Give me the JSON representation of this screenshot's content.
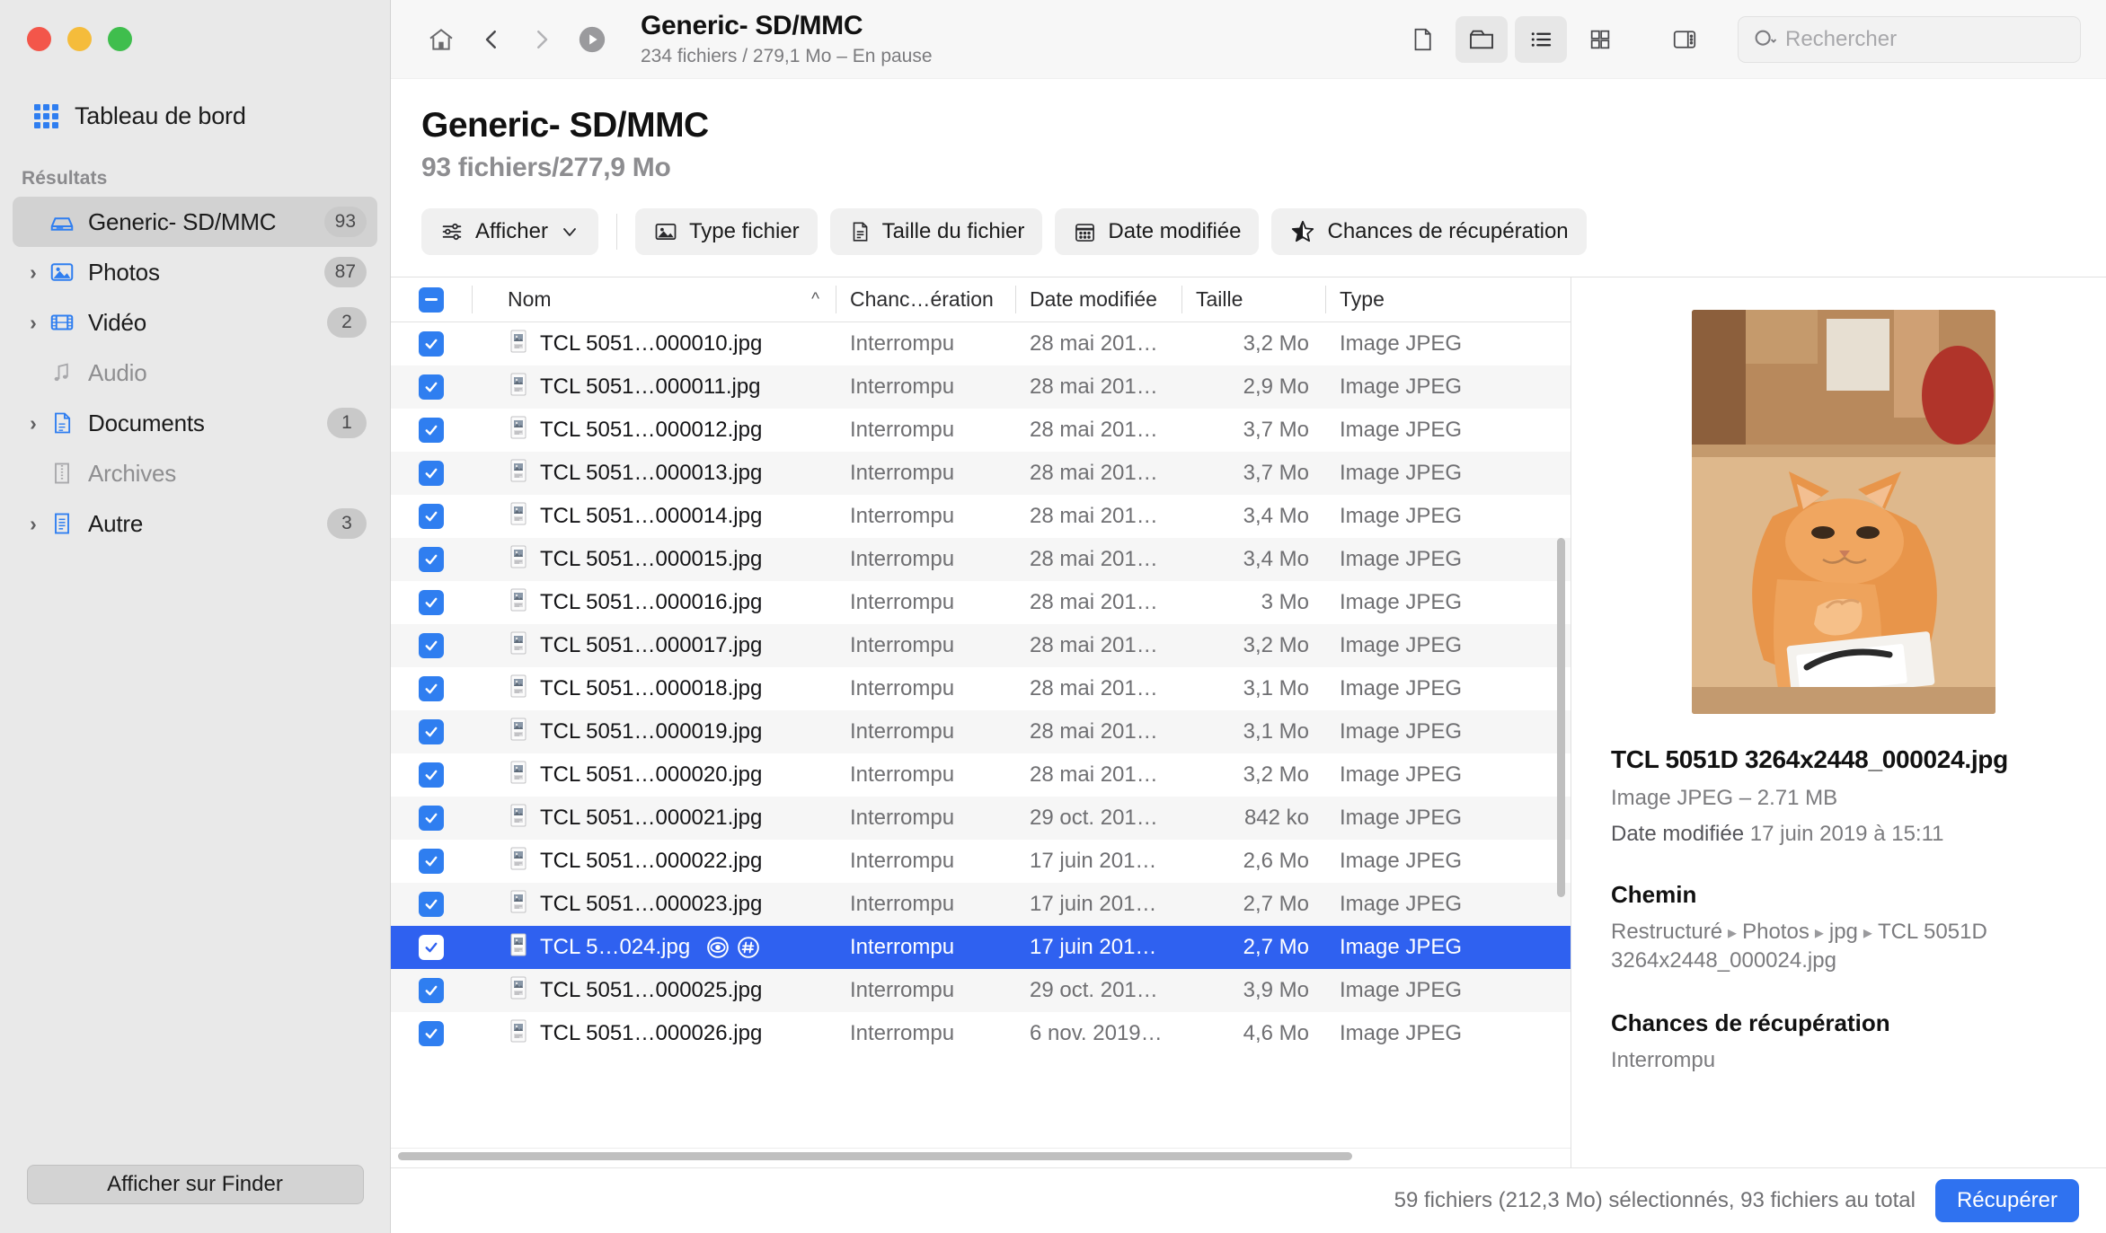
{
  "window": {
    "traffic_lights": [
      "close",
      "minimize",
      "zoom"
    ]
  },
  "sidebar": {
    "dashboard_label": "Tableau de bord",
    "section_label": "Résultats",
    "items": [
      {
        "label": "Generic- SD/MMC",
        "badge": "93",
        "icon": "drive-icon",
        "expandable": false,
        "selected": true,
        "dim": false
      },
      {
        "label": "Photos",
        "badge": "87",
        "icon": "photos-icon",
        "expandable": true,
        "selected": false,
        "dim": false
      },
      {
        "label": "Vidéo",
        "badge": "2",
        "icon": "video-icon",
        "expandable": true,
        "selected": false,
        "dim": false
      },
      {
        "label": "Audio",
        "badge": "",
        "icon": "audio-icon",
        "expandable": false,
        "selected": false,
        "dim": true
      },
      {
        "label": "Documents",
        "badge": "1",
        "icon": "document-icon",
        "expandable": true,
        "selected": false,
        "dim": false
      },
      {
        "label": "Archives",
        "badge": "",
        "icon": "archive-icon",
        "expandable": false,
        "selected": false,
        "dim": true
      },
      {
        "label": "Autre",
        "badge": "3",
        "icon": "other-icon",
        "expandable": true,
        "selected": false,
        "dim": false
      }
    ],
    "finder_button": "Afficher sur Finder"
  },
  "toolbar": {
    "home_icon": "home-icon",
    "back_icon": "chevron-left-icon",
    "forward_icon": "chevron-right-icon",
    "play_icon": "play-circle-icon",
    "title": "Generic- SD/MMC",
    "subtitle": "234 fichiers / 279,1 Mo – En pause",
    "view_icons": [
      "file-view-icon",
      "folder-view-icon",
      "list-view-icon",
      "grid-view-icon",
      "sidebar-toggle-icon"
    ],
    "search_placeholder": "Rechercher"
  },
  "header": {
    "title": "Generic- SD/MMC",
    "subtitle": "93 fichiers/277,9 Mo"
  },
  "filters": {
    "show": {
      "label": "Afficher",
      "icon": "sliders-icon",
      "caret": "chevron-down-icon"
    },
    "pills": [
      {
        "label": "Type fichier",
        "icon": "image-icon"
      },
      {
        "label": "Taille du fichier",
        "icon": "document-icon"
      },
      {
        "label": "Date modifiée",
        "icon": "calendar-icon"
      },
      {
        "label": "Chances de récupération",
        "icon": "star-icon"
      }
    ]
  },
  "table": {
    "columns": [
      "Nom",
      "Chanc…ération",
      "Date modifiée",
      "Taille",
      "Type"
    ],
    "sort_indicator": "^",
    "header_checkbox_state": "indeterminate",
    "rows": [
      {
        "name": "TCL 5051…000010.jpg",
        "chance": "Interrompu",
        "date": "28 mai 201…",
        "size": "3,2 Mo",
        "type": "Image JPEG",
        "checked": true,
        "selected": false
      },
      {
        "name": "TCL 5051…000011.jpg",
        "chance": "Interrompu",
        "date": "28 mai 201…",
        "size": "2,9 Mo",
        "type": "Image JPEG",
        "checked": true,
        "selected": false
      },
      {
        "name": "TCL 5051…000012.jpg",
        "chance": "Interrompu",
        "date": "28 mai 201…",
        "size": "3,7 Mo",
        "type": "Image JPEG",
        "checked": true,
        "selected": false
      },
      {
        "name": "TCL 5051…000013.jpg",
        "chance": "Interrompu",
        "date": "28 mai 201…",
        "size": "3,7 Mo",
        "type": "Image JPEG",
        "checked": true,
        "selected": false
      },
      {
        "name": "TCL 5051…000014.jpg",
        "chance": "Interrompu",
        "date": "28 mai 201…",
        "size": "3,4 Mo",
        "type": "Image JPEG",
        "checked": true,
        "selected": false
      },
      {
        "name": "TCL 5051…000015.jpg",
        "chance": "Interrompu",
        "date": "28 mai 201…",
        "size": "3,4 Mo",
        "type": "Image JPEG",
        "checked": true,
        "selected": false
      },
      {
        "name": "TCL 5051…000016.jpg",
        "chance": "Interrompu",
        "date": "28 mai 201…",
        "size": "3 Mo",
        "type": "Image JPEG",
        "checked": true,
        "selected": false
      },
      {
        "name": "TCL 5051…000017.jpg",
        "chance": "Interrompu",
        "date": "28 mai 201…",
        "size": "3,2 Mo",
        "type": "Image JPEG",
        "checked": true,
        "selected": false
      },
      {
        "name": "TCL 5051…000018.jpg",
        "chance": "Interrompu",
        "date": "28 mai 201…",
        "size": "3,1 Mo",
        "type": "Image JPEG",
        "checked": true,
        "selected": false
      },
      {
        "name": "TCL 5051…000019.jpg",
        "chance": "Interrompu",
        "date": "28 mai 201…",
        "size": "3,1 Mo",
        "type": "Image JPEG",
        "checked": true,
        "selected": false
      },
      {
        "name": "TCL 5051…000020.jpg",
        "chance": "Interrompu",
        "date": "28 mai 201…",
        "size": "3,2 Mo",
        "type": "Image JPEG",
        "checked": true,
        "selected": false
      },
      {
        "name": "TCL 5051…000021.jpg",
        "chance": "Interrompu",
        "date": "29 oct. 201…",
        "size": "842 ko",
        "type": "Image JPEG",
        "checked": true,
        "selected": false
      },
      {
        "name": "TCL 5051…000022.jpg",
        "chance": "Interrompu",
        "date": "17 juin 201…",
        "size": "2,6 Mo",
        "type": "Image JPEG",
        "checked": true,
        "selected": false
      },
      {
        "name": "TCL 5051…000023.jpg",
        "chance": "Interrompu",
        "date": "17 juin 201…",
        "size": "2,7 Mo",
        "type": "Image JPEG",
        "checked": true,
        "selected": false
      },
      {
        "name": "TCL 5…024.jpg",
        "chance": "Interrompu",
        "date": "17 juin 201…",
        "size": "2,7 Mo",
        "type": "Image JPEG",
        "checked": true,
        "selected": true,
        "extra_icons": [
          "preview-eye-icon",
          "hash-icon"
        ]
      },
      {
        "name": "TCL 5051…000025.jpg",
        "chance": "Interrompu",
        "date": "29 oct. 201…",
        "size": "3,9 Mo",
        "type": "Image JPEG",
        "checked": true,
        "selected": false
      },
      {
        "name": "TCL 5051…000026.jpg",
        "chance": "Interrompu",
        "date": "6 nov. 2019…",
        "size": "4,6 Mo",
        "type": "Image JPEG",
        "checked": true,
        "selected": false
      }
    ]
  },
  "details": {
    "preview_alt": "cat-photo-preview",
    "filename": "TCL 5051D 3264x2448_000024.jpg",
    "kind_size": "Image JPEG – 2.71 MB",
    "date_label": "Date modifiée",
    "date_value": "17 juin 2019 à 15:11",
    "path_heading": "Chemin",
    "path_parts": [
      "Restructuré",
      "Photos",
      "jpg",
      "TCL 5051D 3264x2448_000024.jpg"
    ],
    "chance_heading": "Chances de récupération",
    "chance_value": "Interrompu"
  },
  "statusbar": {
    "text": "59 fichiers (212,3 Mo) sélectionnés, 93 fichiers au total",
    "button": "Récupérer"
  },
  "colors": {
    "accent_blue": "#2f72f0",
    "selection_blue": "#2f61f0",
    "checkbox_blue": "#2f7ef0",
    "sidebar_bg": "#e9e9e9"
  }
}
